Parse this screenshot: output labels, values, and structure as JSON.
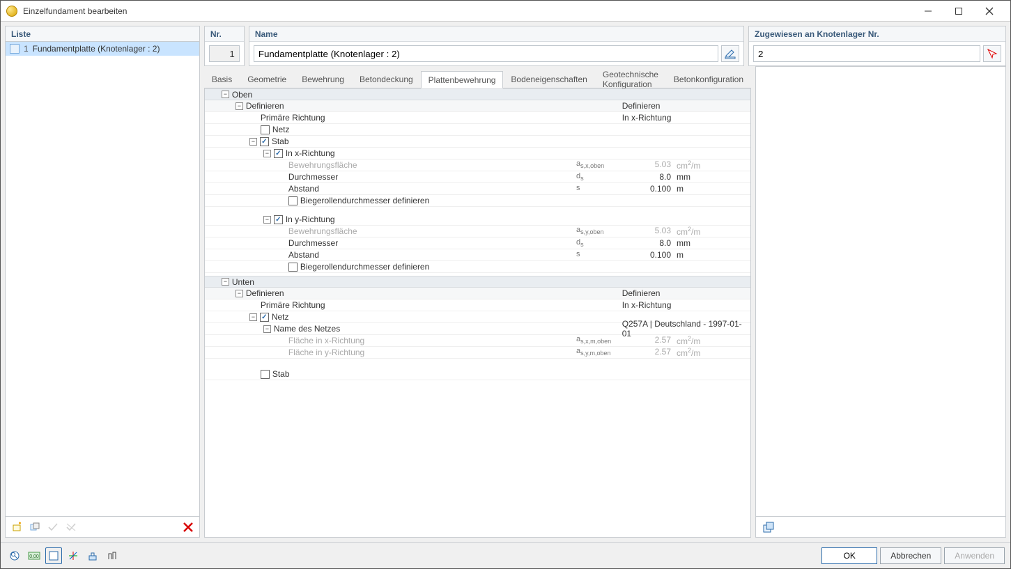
{
  "window": {
    "title": "Einzelfundament bearbeiten"
  },
  "left": {
    "header": "Liste",
    "items": [
      {
        "index": "1",
        "label": "Fundamentplatte (Knotenlager : 2)"
      }
    ]
  },
  "mid_top": {
    "nr_label": "Nr.",
    "nr_value": "1",
    "name_label": "Name",
    "name_value": "Fundamentplatte (Knotenlager : 2)"
  },
  "tabs": [
    "Basis",
    "Geometrie",
    "Bewehrung",
    "Betondeckung",
    "Plattenbewehrung",
    "Bodeneigenschaften",
    "Geotechnische Konfiguration",
    "Betonkonfiguration"
  ],
  "active_tab": 4,
  "grid": {
    "oben": {
      "title": "Oben",
      "definieren": "Definieren",
      "definieren_val": "Definieren",
      "primare": "Primäre Richtung",
      "primare_val": "In x-Richtung",
      "netz": "Netz",
      "stab": "Stab",
      "x": {
        "title": "In x-Richtung",
        "bflaeche": "Bewehrungsfläche",
        "bflaeche_sym": "a_s,x,oben",
        "bflaeche_val": "5.03",
        "bflaeche_unit": "cm²/m",
        "durch": "Durchmesser",
        "durch_sym": "d_s",
        "durch_val": "8.0",
        "durch_unit": "mm",
        "abst": "Abstand",
        "abst_sym": "s",
        "abst_val": "0.100",
        "abst_unit": "m",
        "biege": "Biegerollendurchmesser definieren"
      },
      "y": {
        "title": "In y-Richtung",
        "bflaeche": "Bewehrungsfläche",
        "bflaeche_sym": "a_s,y,oben",
        "bflaeche_val": "5.03",
        "bflaeche_unit": "cm²/m",
        "durch": "Durchmesser",
        "durch_sym": "d_s",
        "durch_val": "8.0",
        "durch_unit": "mm",
        "abst": "Abstand",
        "abst_sym": "s",
        "abst_val": "0.100",
        "abst_unit": "m",
        "biege": "Biegerollendurchmesser definieren"
      }
    },
    "unten": {
      "title": "Unten",
      "definieren": "Definieren",
      "definieren_val": "Definieren",
      "primare": "Primäre Richtung",
      "primare_val": "In x-Richtung",
      "netz": "Netz",
      "name_netz": "Name des Netzes",
      "name_netz_val": "Q257A | Deutschland - 1997-01-01",
      "fx": "Fläche in x-Richtung",
      "fx_sym": "a_s,x,m,oben",
      "fx_val": "2.57",
      "fx_unit": "cm²/m",
      "fy": "Fläche in y-Richtung",
      "fy_sym": "a_s,y,m,oben",
      "fy_val": "2.57",
      "fy_unit": "cm²/m",
      "stab": "Stab"
    }
  },
  "right": {
    "header": "Zugewiesen an Knotenlager Nr.",
    "value": "2"
  },
  "footer": {
    "ok": "OK",
    "cancel": "Abbrechen",
    "apply": "Anwenden"
  }
}
